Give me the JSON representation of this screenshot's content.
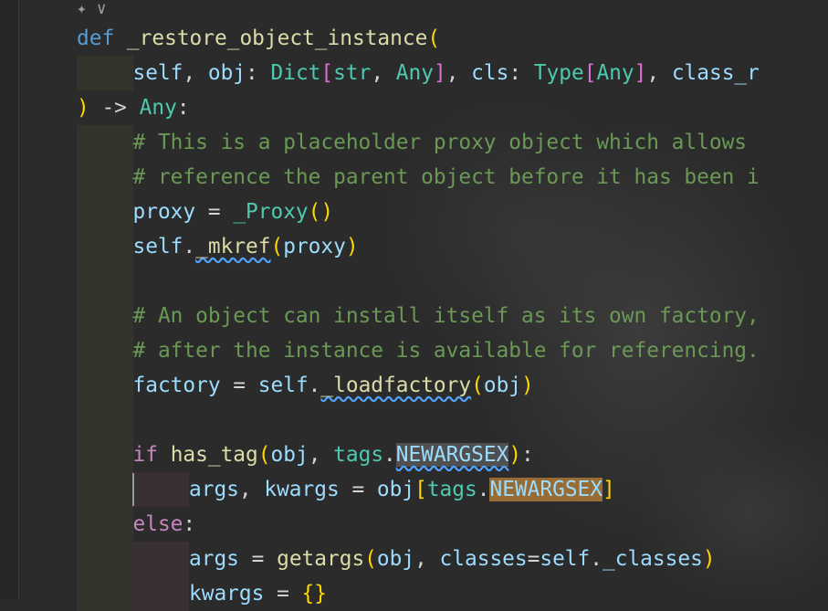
{
  "editor": {
    "top_icons": {
      "ai_icon": "✦",
      "chevron": "∨"
    },
    "lines": [
      {
        "indent": 0,
        "tokens": [
          {
            "t": "def",
            "c": "kw"
          },
          {
            "t": " ",
            "c": "tx"
          },
          {
            "t": "_restore_object_instance",
            "c": "fn"
          },
          {
            "t": "(",
            "c": "br1"
          }
        ]
      },
      {
        "indent": 1,
        "tokens": [
          {
            "t": "self",
            "c": "var"
          },
          {
            "t": ", ",
            "c": "tx"
          },
          {
            "t": "obj",
            "c": "var"
          },
          {
            "t": ": ",
            "c": "tx"
          },
          {
            "t": "Dict",
            "c": "ty"
          },
          {
            "t": "[",
            "c": "br2"
          },
          {
            "t": "str",
            "c": "ty"
          },
          {
            "t": ", ",
            "c": "tx"
          },
          {
            "t": "Any",
            "c": "ty"
          },
          {
            "t": "]",
            "c": "br2"
          },
          {
            "t": ", ",
            "c": "tx"
          },
          {
            "t": "cls",
            "c": "var"
          },
          {
            "t": ": ",
            "c": "tx"
          },
          {
            "t": "Type",
            "c": "ty"
          },
          {
            "t": "[",
            "c": "br2"
          },
          {
            "t": "Any",
            "c": "ty"
          },
          {
            "t": "]",
            "c": "br2"
          },
          {
            "t": ", ",
            "c": "tx"
          },
          {
            "t": "class_r",
            "c": "var"
          }
        ]
      },
      {
        "indent": 0,
        "tokens": [
          {
            "t": ")",
            "c": "br1"
          },
          {
            "t": " -> ",
            "c": "tx"
          },
          {
            "t": "Any",
            "c": "ty"
          },
          {
            "t": ":",
            "c": "tx"
          }
        ]
      },
      {
        "indent": 1,
        "tokens": [
          {
            "t": "# This is a placeholder proxy object which allows",
            "c": "cm"
          }
        ]
      },
      {
        "indent": 1,
        "tokens": [
          {
            "t": "# reference the parent object before it has been i",
            "c": "cm"
          }
        ]
      },
      {
        "indent": 1,
        "tokens": [
          {
            "t": "proxy",
            "c": "var"
          },
          {
            "t": " = ",
            "c": "tx"
          },
          {
            "t": "_Proxy",
            "c": "ty"
          },
          {
            "t": "()",
            "c": "br1"
          }
        ]
      },
      {
        "indent": 1,
        "tokens": [
          {
            "t": "self",
            "c": "var"
          },
          {
            "t": ".",
            "c": "tx"
          },
          {
            "t": "_mkref",
            "c": "fn",
            "u": true
          },
          {
            "t": "(",
            "c": "br1"
          },
          {
            "t": "proxy",
            "c": "var"
          },
          {
            "t": ")",
            "c": "br1"
          }
        ]
      },
      {
        "indent": 1,
        "tokens": []
      },
      {
        "indent": 1,
        "tokens": [
          {
            "t": "# An object can install itself as its own factory,",
            "c": "cm"
          }
        ]
      },
      {
        "indent": 1,
        "tokens": [
          {
            "t": "# after the instance is available for referencing.",
            "c": "cm"
          }
        ]
      },
      {
        "indent": 1,
        "tokens": [
          {
            "t": "factory",
            "c": "var"
          },
          {
            "t": " = ",
            "c": "tx"
          },
          {
            "t": "self",
            "c": "var"
          },
          {
            "t": ".",
            "c": "tx"
          },
          {
            "t": "_loadfactory",
            "c": "fn",
            "u": true
          },
          {
            "t": "(",
            "c": "br1"
          },
          {
            "t": "obj",
            "c": "var"
          },
          {
            "t": ")",
            "c": "br1"
          }
        ]
      },
      {
        "indent": 1,
        "tokens": []
      },
      {
        "indent": 1,
        "tokens": [
          {
            "t": "if",
            "c": "kw2"
          },
          {
            "t": " ",
            "c": "tx"
          },
          {
            "t": "has_tag",
            "c": "fn"
          },
          {
            "t": "(",
            "c": "br1"
          },
          {
            "t": "obj",
            "c": "var"
          },
          {
            "t": ", ",
            "c": "tx"
          },
          {
            "t": "tags",
            "c": "ty"
          },
          {
            "t": ".",
            "c": "tx"
          },
          {
            "t": "NEWARGSEX",
            "c": "var",
            "u": true,
            "h": "hl2"
          },
          {
            "t": ")",
            "c": "br1"
          },
          {
            "t": ":",
            "c": "tx"
          }
        ]
      },
      {
        "indent": 2,
        "tokens": [
          {
            "t": "args",
            "c": "var"
          },
          {
            "t": ", ",
            "c": "tx"
          },
          {
            "t": "kwargs",
            "c": "var"
          },
          {
            "t": " = ",
            "c": "tx"
          },
          {
            "t": "obj",
            "c": "var"
          },
          {
            "t": "[",
            "c": "br1"
          },
          {
            "t": "tags",
            "c": "ty"
          },
          {
            "t": ".",
            "c": "tx"
          },
          {
            "t": "NEWARGSEX",
            "c": "var",
            "h": "hl"
          },
          {
            "t": "]",
            "c": "br1"
          }
        ]
      },
      {
        "indent": 1,
        "tokens": [
          {
            "t": "else",
            "c": "kw2"
          },
          {
            "t": ":",
            "c": "tx"
          }
        ]
      },
      {
        "indent": 2,
        "tokens": [
          {
            "t": "args",
            "c": "var"
          },
          {
            "t": " = ",
            "c": "tx"
          },
          {
            "t": "getargs",
            "c": "fn"
          },
          {
            "t": "(",
            "c": "br1"
          },
          {
            "t": "obj",
            "c": "var"
          },
          {
            "t": ", ",
            "c": "tx"
          },
          {
            "t": "classes",
            "c": "var"
          },
          {
            "t": "=",
            "c": "tx"
          },
          {
            "t": "self",
            "c": "var"
          },
          {
            "t": ".",
            "c": "tx"
          },
          {
            "t": "_classes",
            "c": "var"
          },
          {
            "t": ")",
            "c": "br1"
          }
        ]
      },
      {
        "indent": 2,
        "tokens": [
          {
            "t": "kwargs",
            "c": "var"
          },
          {
            "t": " = ",
            "c": "tx"
          },
          {
            "t": "{}",
            "c": "br1"
          }
        ]
      }
    ]
  }
}
